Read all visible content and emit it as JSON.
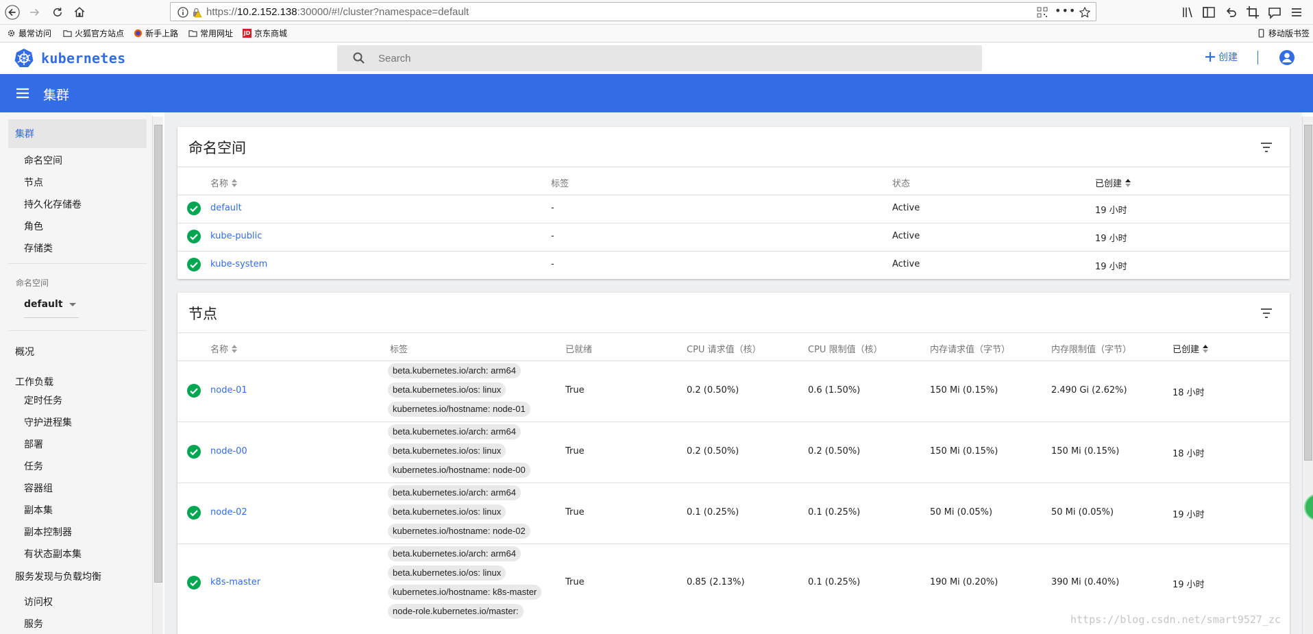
{
  "browser": {
    "url_prefix": "https://",
    "url_host": "10.2.152.138",
    "url_rest": ":30000/#!/cluster?namespace=default",
    "bookmarks": [
      "最常访问",
      "火狐官方站点",
      "新手上路",
      "常用网址",
      "京东商城"
    ],
    "mobile_bookmarks": "移动版书签",
    "jd_icon_label": "JD"
  },
  "header": {
    "brand": "kubernetes",
    "search_placeholder": "Search",
    "create_label": "创建"
  },
  "toolbar": {
    "title": "集群"
  },
  "sidebar": {
    "cluster_label": "集群",
    "cluster_items": [
      "命名空间",
      "节点",
      "持久化存储卷",
      "角色",
      "存储类"
    ],
    "namespace_caption": "命名空间",
    "namespace_value": "default",
    "overview_label": "概况",
    "workloads_label": "工作负载",
    "workload_items": [
      "定时任务",
      "守护进程集",
      "部署",
      "任务",
      "容器组",
      "副本集",
      "副本控制器",
      "有状态副本集"
    ],
    "discovery_label": "服务发现与负载均衡",
    "discovery_items": [
      "访问权",
      "服务"
    ]
  },
  "namespaces": {
    "title": "命名空间",
    "columns": {
      "name": "名称",
      "labels": "标签",
      "status": "状态",
      "created": "已创建"
    },
    "rows": [
      {
        "name": "default",
        "labels": "-",
        "status": "Active",
        "created": "19 小时"
      },
      {
        "name": "kube-public",
        "labels": "-",
        "status": "Active",
        "created": "19 小时"
      },
      {
        "name": "kube-system",
        "labels": "-",
        "status": "Active",
        "created": "19 小时"
      }
    ]
  },
  "nodes": {
    "title": "节点",
    "columns": {
      "name": "名称",
      "labels": "标签",
      "ready": "已就绪",
      "cpu_req": "CPU 请求值（核）",
      "cpu_lim": "CPU 限制值（核）",
      "mem_req": "内存请求值（字节）",
      "mem_lim": "内存限制值（字节）",
      "created": "已创建"
    },
    "rows": [
      {
        "name": "node-01",
        "labels": [
          "beta.kubernetes.io/arch: arm64",
          "beta.kubernetes.io/os: linux",
          "kubernetes.io/hostname: node-01"
        ],
        "ready": "True",
        "cpu_req": "0.2 (0.50%)",
        "cpu_lim": "0.6 (1.50%)",
        "mem_req": "150 Mi (0.15%)",
        "mem_lim": "2.490 Gi (2.62%)",
        "created": "18 小时"
      },
      {
        "name": "node-00",
        "labels": [
          "beta.kubernetes.io/arch: arm64",
          "beta.kubernetes.io/os: linux",
          "kubernetes.io/hostname: node-00"
        ],
        "ready": "True",
        "cpu_req": "0.2 (0.50%)",
        "cpu_lim": "0.2 (0.50%)",
        "mem_req": "150 Mi (0.15%)",
        "mem_lim": "150 Mi (0.15%)",
        "created": "18 小时"
      },
      {
        "name": "node-02",
        "labels": [
          "beta.kubernetes.io/arch: arm64",
          "beta.kubernetes.io/os: linux",
          "kubernetes.io/hostname: node-02"
        ],
        "ready": "True",
        "cpu_req": "0.1 (0.25%)",
        "cpu_lim": "0.1 (0.25%)",
        "mem_req": "50 Mi (0.05%)",
        "mem_lim": "50 Mi (0.05%)",
        "created": "19 小时"
      },
      {
        "name": "k8s-master",
        "labels": [
          "beta.kubernetes.io/arch: arm64",
          "beta.kubernetes.io/os: linux",
          "kubernetes.io/hostname: k8s-master",
          "node-role.kubernetes.io/master:"
        ],
        "ready": "True",
        "cpu_req": "0.85 (2.13%)",
        "cpu_lim": "0.1 (0.25%)",
        "mem_req": "190 Mi (0.20%)",
        "mem_lim": "390 Mi (0.40%)",
        "created": "19 小时"
      }
    ]
  },
  "watermark": "https://blog.csdn.net/smart9527_zc",
  "colors": {
    "accent": "#326de6",
    "success": "#00a651"
  }
}
